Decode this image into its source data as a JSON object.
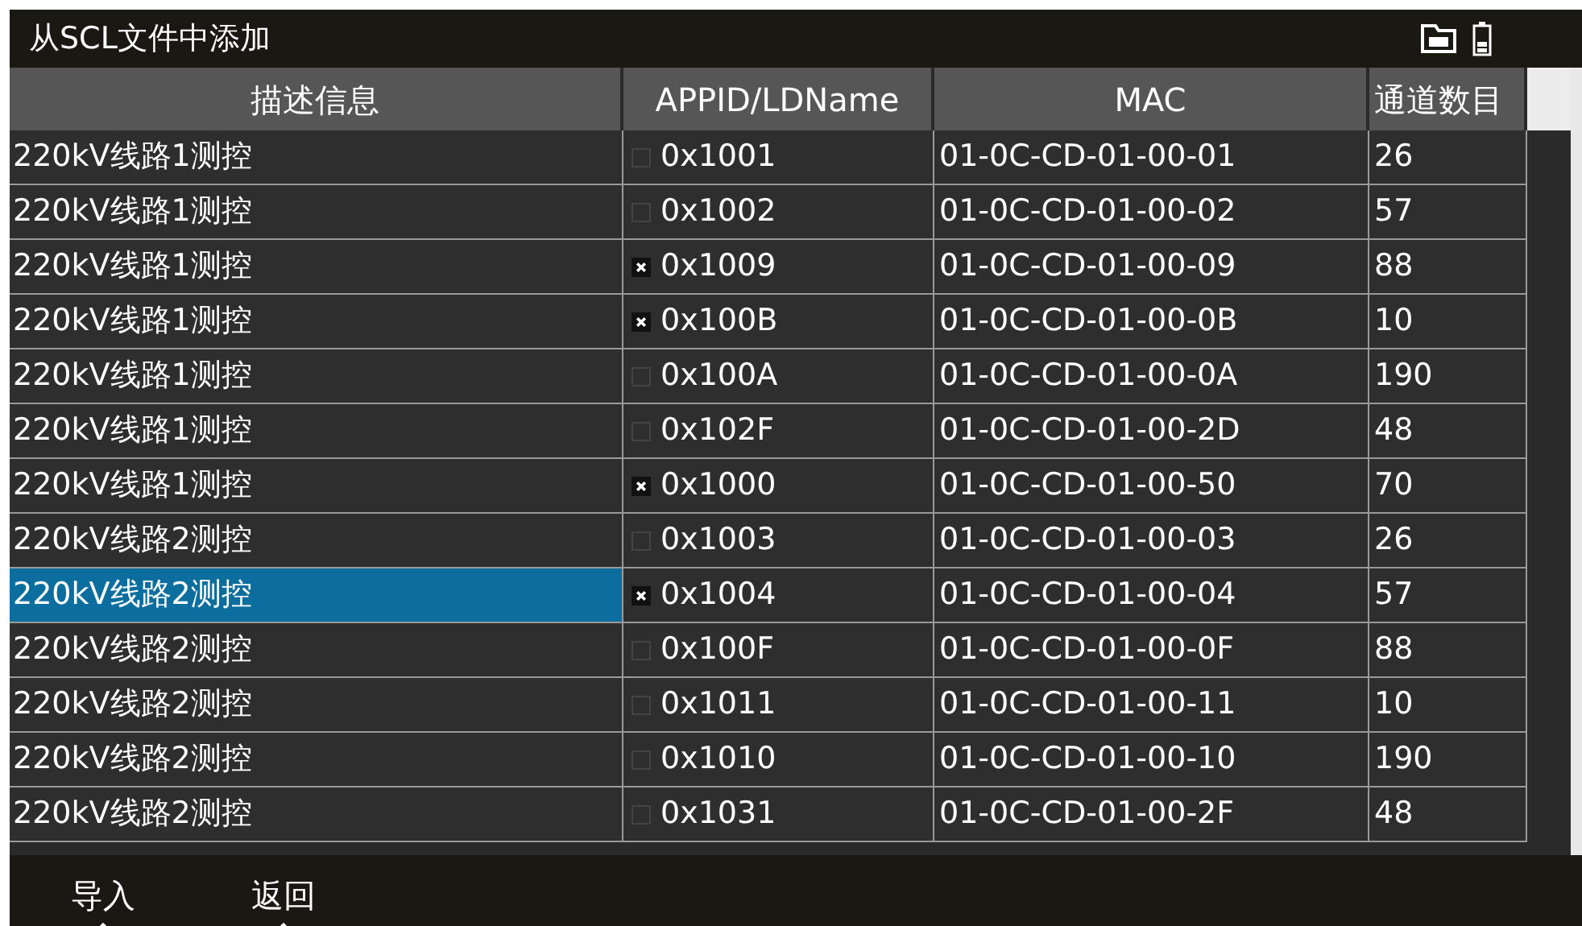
{
  "window": {
    "title": "从SCL文件中添加"
  },
  "table": {
    "columns": [
      "描述信息",
      "APPID/LDName",
      "MAC",
      "通道数目"
    ],
    "rows": [
      {
        "description": "220kV线路1测控",
        "appid": "0x1001",
        "mac": "01-0C-CD-01-00-01",
        "channels": "26",
        "checked": false,
        "selected": false
      },
      {
        "description": "220kV线路1测控",
        "appid": "0x1002",
        "mac": "01-0C-CD-01-00-02",
        "channels": "57",
        "checked": false,
        "selected": false
      },
      {
        "description": "220kV线路1测控",
        "appid": "0x1009",
        "mac": "01-0C-CD-01-00-09",
        "channels": "88",
        "checked": true,
        "selected": false
      },
      {
        "description": "220kV线路1测控",
        "appid": "0x100B",
        "mac": "01-0C-CD-01-00-0B",
        "channels": "10",
        "checked": true,
        "selected": false
      },
      {
        "description": "220kV线路1测控",
        "appid": "0x100A",
        "mac": "01-0C-CD-01-00-0A",
        "channels": "190",
        "checked": false,
        "selected": false
      },
      {
        "description": "220kV线路1测控",
        "appid": "0x102F",
        "mac": "01-0C-CD-01-00-2D",
        "channels": "48",
        "checked": false,
        "selected": false
      },
      {
        "description": "220kV线路1测控",
        "appid": "0x1000",
        "mac": "01-0C-CD-01-00-50",
        "channels": "70",
        "checked": true,
        "selected": false
      },
      {
        "description": "220kV线路2测控",
        "appid": "0x1003",
        "mac": "01-0C-CD-01-00-03",
        "channels": "26",
        "checked": false,
        "selected": false
      },
      {
        "description": "220kV线路2测控",
        "appid": "0x1004",
        "mac": "01-0C-CD-01-00-04",
        "channels": "57",
        "checked": true,
        "selected": true
      },
      {
        "description": "220kV线路2测控",
        "appid": "0x100F",
        "mac": "01-0C-CD-01-00-0F",
        "channels": "88",
        "checked": false,
        "selected": false
      },
      {
        "description": "220kV线路2测控",
        "appid": "0x1011",
        "mac": "01-0C-CD-01-00-11",
        "channels": "10",
        "checked": false,
        "selected": false
      },
      {
        "description": "220kV线路2测控",
        "appid": "0x1010",
        "mac": "01-0C-CD-01-00-10",
        "channels": "190",
        "checked": false,
        "selected": false
      },
      {
        "description": "220kV线路2测控",
        "appid": "0x1031",
        "mac": "01-0C-CD-01-00-2F",
        "channels": "48",
        "checked": false,
        "selected": false
      }
    ]
  },
  "softkeys": [
    "导入",
    "返回"
  ]
}
